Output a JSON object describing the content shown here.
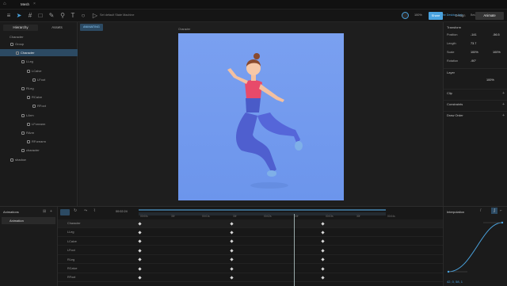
{
  "titlebar": {
    "title": "Mesh"
  },
  "toolbar": {
    "state_machine_label": "Set default State Machine",
    "promo_link": "Get the Desktop App",
    "version": "Beta 0.8.598",
    "zoom": "100%",
    "share_label": "Share",
    "mode_tabs": [
      "Design",
      "Animate"
    ],
    "active_mode": "Animate"
  },
  "left_panel": {
    "tabs": [
      "Hierarchy",
      "Assets"
    ],
    "root_label": "Character",
    "tree": [
      {
        "label": "Group",
        "indent": 1,
        "icon": "group-icon"
      },
      {
        "label": "Character",
        "indent": 2,
        "icon": "mesh-icon",
        "selected": true
      },
      {
        "label": "LLeg",
        "indent": 3,
        "icon": "bone-icon"
      },
      {
        "label": "LCalve",
        "indent": 4,
        "icon": "bone-icon"
      },
      {
        "label": "LFoot",
        "indent": 5,
        "icon": "bone-icon"
      },
      {
        "label": "RLeg",
        "indent": 3,
        "icon": "bone-icon"
      },
      {
        "label": "RCalve",
        "indent": 4,
        "icon": "bone-icon"
      },
      {
        "label": "RFoot",
        "indent": 5,
        "icon": "bone-icon"
      },
      {
        "label": "LArm",
        "indent": 3,
        "icon": "bone-icon"
      },
      {
        "label": "LForearm",
        "indent": 4,
        "icon": "bone-icon"
      },
      {
        "label": "RArm",
        "indent": 3,
        "icon": "bone-icon"
      },
      {
        "label": "RForearm",
        "indent": 4,
        "icon": "bone-icon"
      },
      {
        "label": "character",
        "indent": 3,
        "icon": "image-icon"
      },
      {
        "label": "shadow",
        "indent": 1,
        "icon": "image-icon"
      }
    ]
  },
  "canvas": {
    "mode_badge": "ANIMATING",
    "artboard_label": "Character"
  },
  "right_panel": {
    "transform_title": "Transform",
    "position_label": "Position",
    "position_x": "-141",
    "position_y": "-56.5",
    "length_label": "Length",
    "length_value": "73.7",
    "scale_label": "Scale",
    "scale_x": "100%",
    "scale_y": "100%",
    "rotation_label": "Rotation",
    "rotation_value": "-90°",
    "layer_title": "Layer",
    "layer_blend": "100%",
    "clip_title": "Clip",
    "constraints_title": "Constraints",
    "draw_order_title": "Draw Order"
  },
  "animations_panel": {
    "title": "Animations",
    "items": [
      "Animation"
    ]
  },
  "timeline": {
    "current_time": "00:02:24",
    "ruler_labels": [
      "00:00s",
      "30f",
      "00:01s",
      "30f",
      "00:02s",
      "30f",
      "00:03s",
      "30f",
      "00:04s"
    ],
    "rows": [
      "Character",
      "LLeg",
      "LCalve",
      "LFoot",
      "RLeg",
      "RCalve",
      "RFoot"
    ]
  },
  "interpolation_panel": {
    "title": "Interpolation",
    "values": "42, 0, 58, 1"
  },
  "colors": {
    "accent": "#4aa3df",
    "artboard": "#7299ee",
    "selection": "#2c4a63"
  }
}
